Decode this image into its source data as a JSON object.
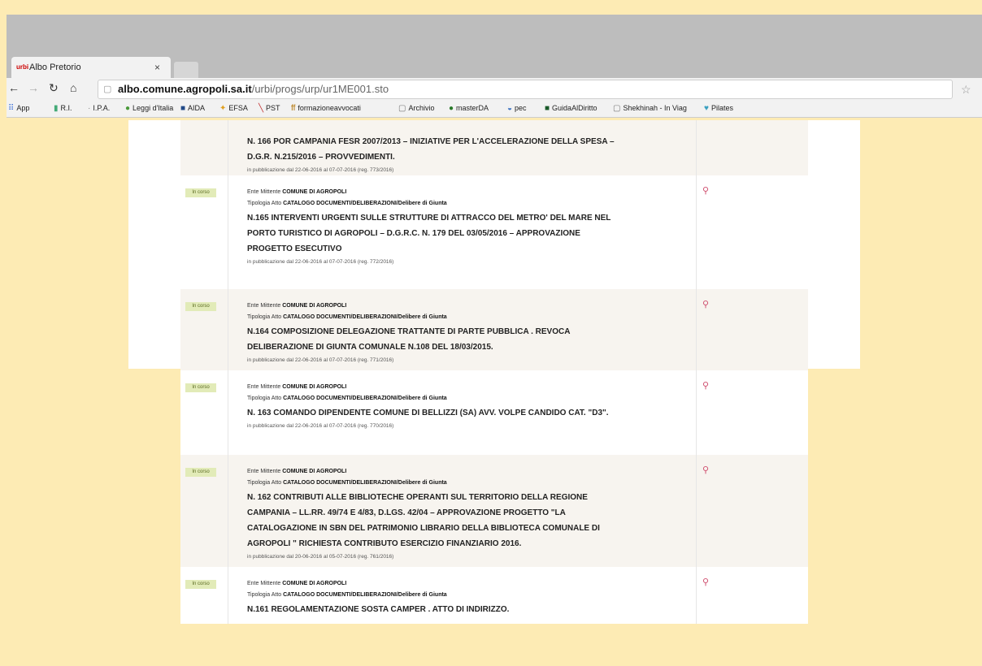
{
  "browser": {
    "tab_title": "Albo Pretorio",
    "tab_favicon": "urbi",
    "tab_close": "×",
    "url_host": "albo.comune.agropoli.sa.it",
    "url_path": "/urbi/progs/urp/ur1ME001.sto",
    "bookmarks": [
      "App",
      "R.I.",
      "I.P.A.",
      "Leggi d'Italia",
      "AIDA",
      "EFSA",
      "PST",
      "formazioneavvocati",
      "Archivio",
      "masterDA",
      "pec",
      "GuidaAlDiritto",
      "Shekhinah - In Viag",
      "Pilates"
    ]
  },
  "list": {
    "sender_label": "Ente Mittente",
    "type_label": "Tipologia Atto",
    "items": [
      {
        "badge": "",
        "sender": "",
        "type": "",
        "subject_lines": [
          "N. 166 POR CAMPANIA FESR 2007/2013 – INIZIATIVE PER L'ACCELERAZIONE DELLA SPESA –",
          "D.G.R. N.215/2016 – PROVVEDIMENTI."
        ],
        "publication": "in pubblicazione dal 22-06-2016 al 07-07-2016 (reg. 773/2016)"
      },
      {
        "badge": "In corso",
        "sender": "COMUNE DI AGROPOLI",
        "type": "CATALOGO DOCUMENTI/DELIBERAZIONI/Delibere di Giunta",
        "subject_lines": [
          "N.165 INTERVENTI URGENTI SULLE STRUTTURE DI ATTRACCO DEL METRO' DEL MARE NEL",
          "PORTO TURISTICO DI AGROPOLI – D.G.R.C. N. 179 DEL 03/05/2016 – APPROVAZIONE",
          "PROGETTO ESECUTIVO"
        ],
        "publication": "in pubblicazione dal 22-06-2016 al 07-07-2016 (reg. 772/2016)"
      },
      {
        "badge": "In corso",
        "sender": "COMUNE DI AGROPOLI",
        "type": "CATALOGO DOCUMENTI/DELIBERAZIONI/Delibere di Giunta",
        "subject_lines": [
          "N.164 COMPOSIZIONE DELEGAZIONE TRATTANTE DI PARTE PUBBLICA . REVOCA",
          "DELIBERAZIONE DI GIUNTA COMUNALE N.108 DEL 18/03/2015."
        ],
        "publication": "in pubblicazione dal 22-06-2016 al 07-07-2016 (reg. 771/2016)"
      },
      {
        "badge": "In corso",
        "sender": "COMUNE DI AGROPOLI",
        "type": "CATALOGO DOCUMENTI/DELIBERAZIONI/Delibere di Giunta",
        "subject_lines": [
          "N. 163 COMANDO DIPENDENTE COMUNE DI BELLIZZI (SA) AVV. VOLPE CANDIDO CAT. \"D3\"."
        ],
        "publication": "in pubblicazione dal 22-06-2016 al 07-07-2016 (reg. 770/2016)"
      },
      {
        "badge": "In corso",
        "sender": "COMUNE DI AGROPOLI",
        "type": "CATALOGO DOCUMENTI/DELIBERAZIONI/Delibere di Giunta",
        "subject_lines": [
          "N. 162 CONTRIBUTI ALLE BIBLIOTECHE OPERANTI SUL TERRITORIO DELLA REGIONE",
          "CAMPANIA – LL.RR. 49/74 E 4/83, D.LGS. 42/04 – APPROVAZIONE PROGETTO \"LA",
          "CATALOGAZIONE IN SBN DEL PATRIMONIO LIBRARIO DELLA BIBLIOTECA COMUNALE DI",
          "AGROPOLI \" RICHIESTA CONTRIBUTO ESERCIZIO FINANZIARIO 2016."
        ],
        "publication": "in pubblicazione dal 20-06-2016 al 05-07-2016 (reg. 761/2016)"
      },
      {
        "badge": "In corso",
        "sender": "COMUNE DI AGROPOLI",
        "type": "CATALOGO DOCUMENTI/DELIBERAZIONI/Delibere di Giunta",
        "subject_lines": [
          "N.161 REGOLAMENTAZIONE SOSTA CAMPER . ATTO DI INDIRIZZO."
        ],
        "publication": ""
      }
    ]
  }
}
